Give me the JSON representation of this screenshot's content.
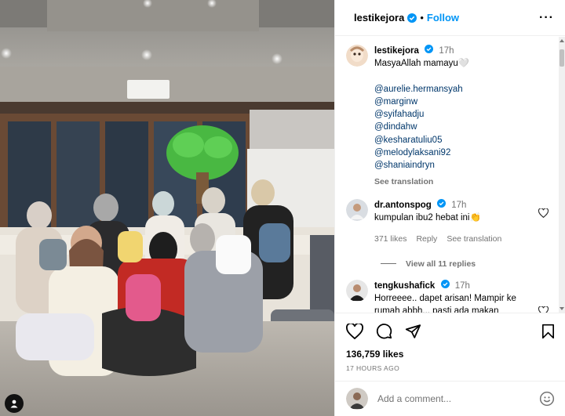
{
  "post": {
    "author": "lestikejora",
    "follow_label": "Follow",
    "separator": "•",
    "more_label": "···"
  },
  "caption": {
    "username": "lestikejora",
    "time": "17h",
    "text": "MasyaAllah mamayu🤍",
    "mentions": [
      "@aurelie.hermansyah",
      "@marginw",
      "@syifahadju",
      "@dindahw",
      "@kesharatuliu05",
      "@melodylaksani92",
      "@shaniaindryn"
    ],
    "see_translation": "See translation"
  },
  "comments": [
    {
      "username": "dr.antonspog",
      "time": "17h",
      "text": "kumpulan ibu2 hebat ini👏",
      "likes": "371 likes",
      "reply": "Reply",
      "see_translation": "See translation",
      "view_replies": "View all 11 replies"
    },
    {
      "username": "tengkushafick",
      "time": "17h",
      "text": "Horreeee.. dapet arisan! Mampir ke rumah abbh... pasti ada makan"
    }
  ],
  "likes_count": "136,759 likes",
  "time_ago": "17 HOURS AGO",
  "add_comment_placeholder": "Add a comment...",
  "icons": {
    "verified": "verified-badge-icon",
    "like": "heart-icon",
    "comment": "comment-icon",
    "share": "share-icon",
    "save": "bookmark-icon",
    "emoji": "emoji-icon",
    "tags": "user-tag-icon"
  },
  "colors": {
    "accent": "#0095f6",
    "verified": "#0095f6",
    "muted": "#737373",
    "mention": "#00376b"
  }
}
